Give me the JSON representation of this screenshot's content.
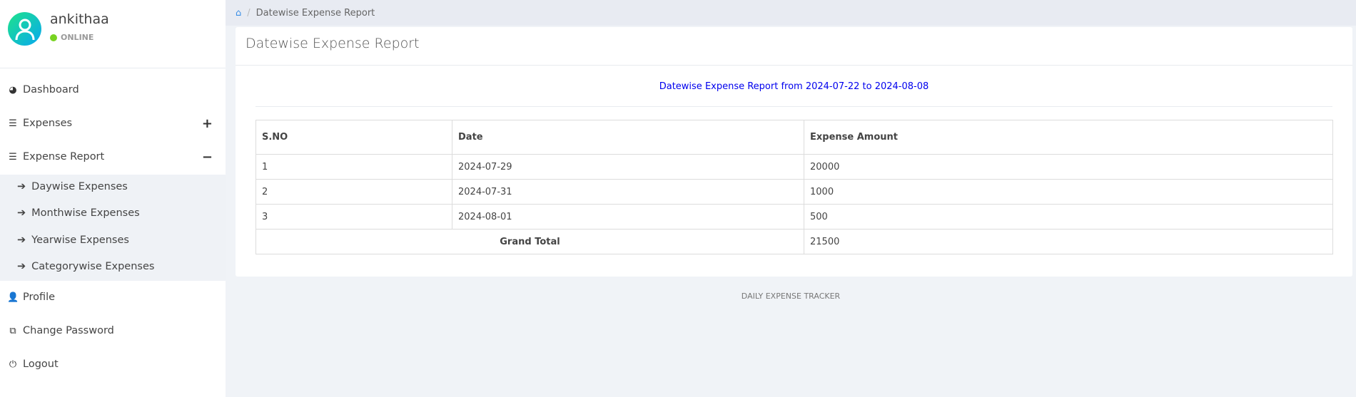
{
  "user": {
    "name": "ankithaa",
    "status": "ONLINE"
  },
  "sidebar": {
    "items": [
      {
        "label": "Dashboard",
        "icon": "dashboard-icon"
      },
      {
        "label": "Expenses",
        "icon": "bars-icon",
        "toggle": "+"
      },
      {
        "label": "Expense Report",
        "icon": "bars-icon",
        "toggle": "−"
      },
      {
        "label": "Profile",
        "icon": "user-icon"
      },
      {
        "label": "Change Password",
        "icon": "copy-icon"
      },
      {
        "label": "Logout",
        "icon": "power-icon"
      }
    ],
    "submenu": [
      "Daywise Expenses",
      "Monthwise Expenses",
      "Yearwise Expenses",
      "Categorywise Expenses"
    ]
  },
  "breadcrumb": {
    "current": "Datewise Expense Report"
  },
  "card": {
    "title": "Datewise Expense Report",
    "subtitle": "Datewise Expense Report from 2024-07-22 to 2024-08-08"
  },
  "table": {
    "headers": [
      "S.NO",
      "Date",
      "Expense Amount"
    ],
    "rows": [
      [
        "1",
        "2024-07-29",
        "20000"
      ],
      [
        "2",
        "2024-07-31",
        "1000"
      ],
      [
        "3",
        "2024-08-01",
        "500"
      ]
    ],
    "total_label": "Grand Total",
    "total": "21500"
  },
  "footer": "DAILY EXPENSE TRACKER",
  "colors": {
    "accent": "#0000ee",
    "online": "#78d321"
  }
}
